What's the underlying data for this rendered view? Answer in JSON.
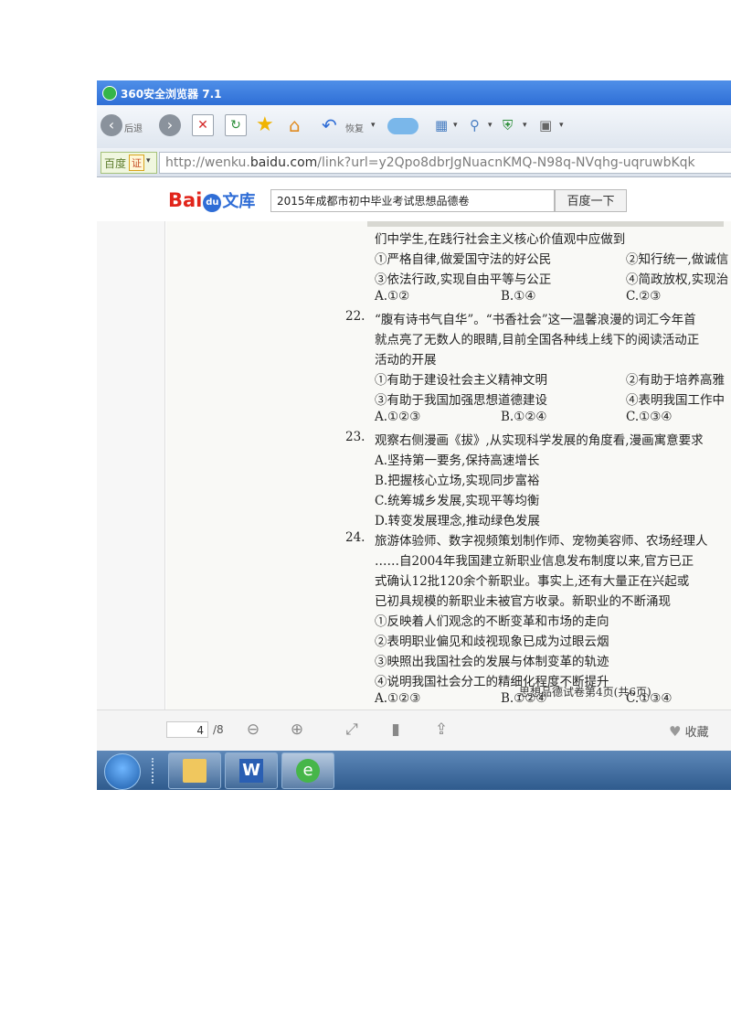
{
  "browser": {
    "title": "360安全浏览器 7.1",
    "toolbar": {
      "back_label": "后退",
      "restore_label": "恢复"
    },
    "search_engine": "百度",
    "engine_badge": "证",
    "url_prefix": "http://wenku.",
    "url_domain": "baidu.com",
    "url_suffix": "/link?url=y2Qpo8dbrJgNuacnKMQ-N98q-NVqhg-uqruwbKqk"
  },
  "wenku": {
    "logo_text_1": "Bai",
    "logo_paw": "du",
    "logo_text_2": "文库",
    "search_value": "2015年成都市初中毕业考试思想品德卷",
    "search_button": "百度一下"
  },
  "document": {
    "lines": [
      "们中学生,在践行社会主义核心价值观中应做到",
      "①严格自律,做爱国守法的好公民",
      "②知行统一,做诚信",
      "③依法行政,实现自由平等与公正",
      "④简政放权,实现治",
      "A.①②",
      "B.①④",
      "C.②③",
      "“腹有诗书气自华”。“书香社会”这一温馨浪漫的词汇今年首",
      "就点亮了无数人的眼睛,目前全国各种线上线下的阅读活动正",
      "活动的开展",
      "①有助于建设社会主义精神文明",
      "②有助于培养高雅",
      "③有助于我国加强思想道德建设",
      "④表明我国工作中",
      "A.①②③",
      "B.①②④",
      "C.①③④",
      "观察右侧漫画《拔》,从实现科学发展的角度看,漫画寓意要求",
      "A.坚持第一要务,保持高速增长",
      "B.把握核心立场,实现同步富裕",
      "C.统筹城乡发展,实现平等均衡",
      "D.转变发展理念,推动绿色发展",
      "旅游体验师、数字视频策划制作师、宠物美容师、农场经理人",
      "……自2004年我国建立新职业信息发布制度以来,官方已正",
      "式确认12批120余个新职业。事实上,还有大量正在兴起或",
      "已初具规模的新职业未被官方收录。新职业的不断涌现",
      "①反映着人们观念的不断变革和市场的走向",
      "②表明职业偏见和歧视现象已成为过眼云烟",
      "③映照出我国社会的发展与体制变革的轨迹",
      "④说明我国社会分工的精细化程度不断提升",
      "A.①②③",
      "B.①②④",
      "C.①③④"
    ],
    "question_numbers": [
      "22.",
      "23.",
      "24."
    ],
    "footer": "思想品德试卷第4页(共6页)"
  },
  "viewer": {
    "page_current": "4",
    "page_total": "/8",
    "favorite_label": "收藏"
  }
}
